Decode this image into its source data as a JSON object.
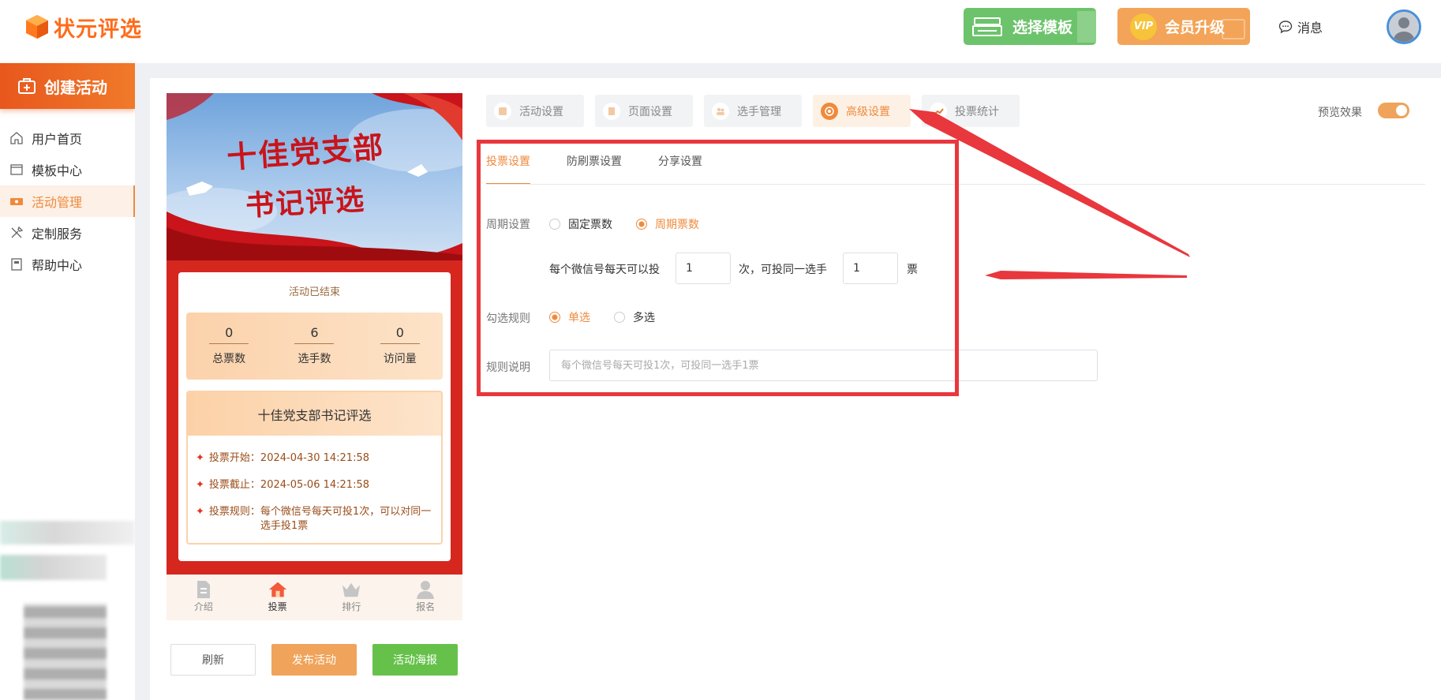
{
  "app": {
    "logo_text": "状元评选",
    "brand_color": "#ff6b1a",
    "accent_color": "#ef8a3c"
  },
  "header": {
    "template_button": "选择模板",
    "vip_badge": "VIP",
    "vip_button": "会员升级",
    "messages": "消息",
    "icons": [
      "template-icon",
      "vip-icon",
      "message-icon",
      "avatar"
    ]
  },
  "sidebar": {
    "create_button": "创建活动",
    "items": [
      {
        "label": "用户首页",
        "icon": "home-icon",
        "active": false
      },
      {
        "label": "模板中心",
        "icon": "folder-icon",
        "active": false
      },
      {
        "label": "活动管理",
        "icon": "ticket-icon",
        "active": true
      },
      {
        "label": "定制服务",
        "icon": "tools-icon",
        "active": false
      },
      {
        "label": "帮助中心",
        "icon": "book-icon",
        "active": false
      }
    ]
  },
  "preview": {
    "banner_line1": "十佳党支部",
    "banner_line2": "书记评选",
    "status": "活动已结束",
    "stats": [
      {
        "value": "0",
        "label": "总票数"
      },
      {
        "value": "6",
        "label": "选手数"
      },
      {
        "value": "0",
        "label": "访问量"
      }
    ],
    "title": "十佳党支部书记评选",
    "vote_start_label": "投票开始：",
    "vote_start": "2024-04-30 14:21:58",
    "vote_end_label": "投票截止：",
    "vote_end": "2024-05-06 14:21:58",
    "vote_rule_label": "投票规则：",
    "vote_rule": "每个微信号每天可投1次，可以对同一选手投1票",
    "tabbar": [
      "介绍",
      "投票",
      "排行",
      "报名"
    ],
    "active_tab": "投票"
  },
  "actions": {
    "refresh": "刷新",
    "publish": "发布活动",
    "poster": "活动海报"
  },
  "tabs": [
    {
      "label": "活动设置",
      "active": false
    },
    {
      "label": "页面设置",
      "active": false
    },
    {
      "label": "选手管理",
      "active": false
    },
    {
      "label": "高级设置",
      "active": true
    },
    {
      "label": "投票统计",
      "active": false
    }
  ],
  "preview_toggle": {
    "label": "预览效果",
    "on": true
  },
  "subtabs": [
    {
      "label": "投票设置",
      "active": true
    },
    {
      "label": "防刷票设置",
      "active": false
    },
    {
      "label": "分享设置",
      "active": false
    }
  ],
  "form": {
    "period_label": "周期设置",
    "period_options": [
      {
        "label": "固定票数",
        "selected": false
      },
      {
        "label": "周期票数",
        "selected": true
      }
    ],
    "per_day_prefix": "每个微信号每天可以投",
    "per_day_value": "1",
    "per_day_middle": "次，可投同一选手",
    "per_player_value": "1",
    "per_player_suffix": "票",
    "select_rule_label": "勾选规则",
    "select_options": [
      {
        "label": "单选",
        "selected": true
      },
      {
        "label": "多选",
        "selected": false
      }
    ],
    "rule_desc_label": "规则说明",
    "rule_desc_placeholder": "每个微信号每天可投1次，可投同一选手1票",
    "rule_desc_value": ""
  },
  "annotation_color": "#e8373d"
}
